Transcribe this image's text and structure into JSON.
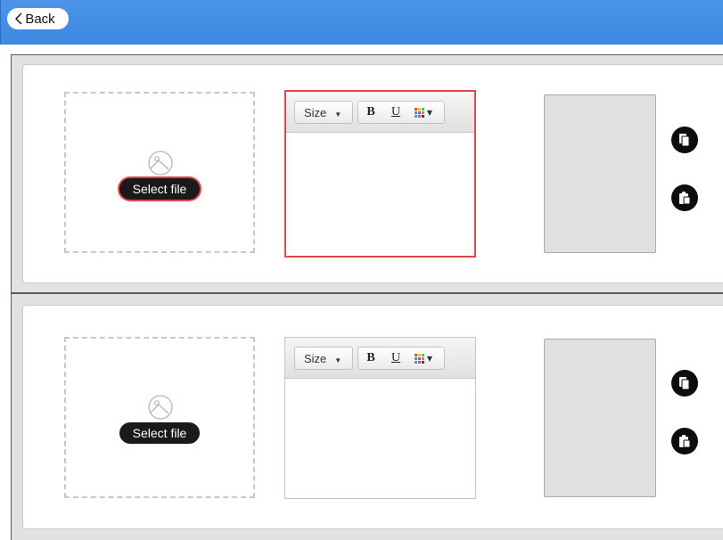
{
  "header": {
    "back_label": "Back"
  },
  "items": [
    {
      "dropzone": {
        "select_label": "Select file"
      },
      "editor": {
        "size_label": "Size",
        "bold_label": "B",
        "underline_label": "U"
      }
    },
    {
      "dropzone": {
        "select_label": "Select file"
      },
      "editor": {
        "size_label": "Size",
        "bold_label": "B",
        "underline_label": "U"
      }
    }
  ],
  "icons": {
    "back": "chevron-left-icon",
    "image": "image-placeholder-icon",
    "copy": "copy-icon",
    "paste": "paste-icon",
    "color": "color-grid-icon"
  },
  "colors": {
    "header_blue": "#3d89e0",
    "focus_red": "#e0474c",
    "button_black": "#1a1a1a"
  }
}
